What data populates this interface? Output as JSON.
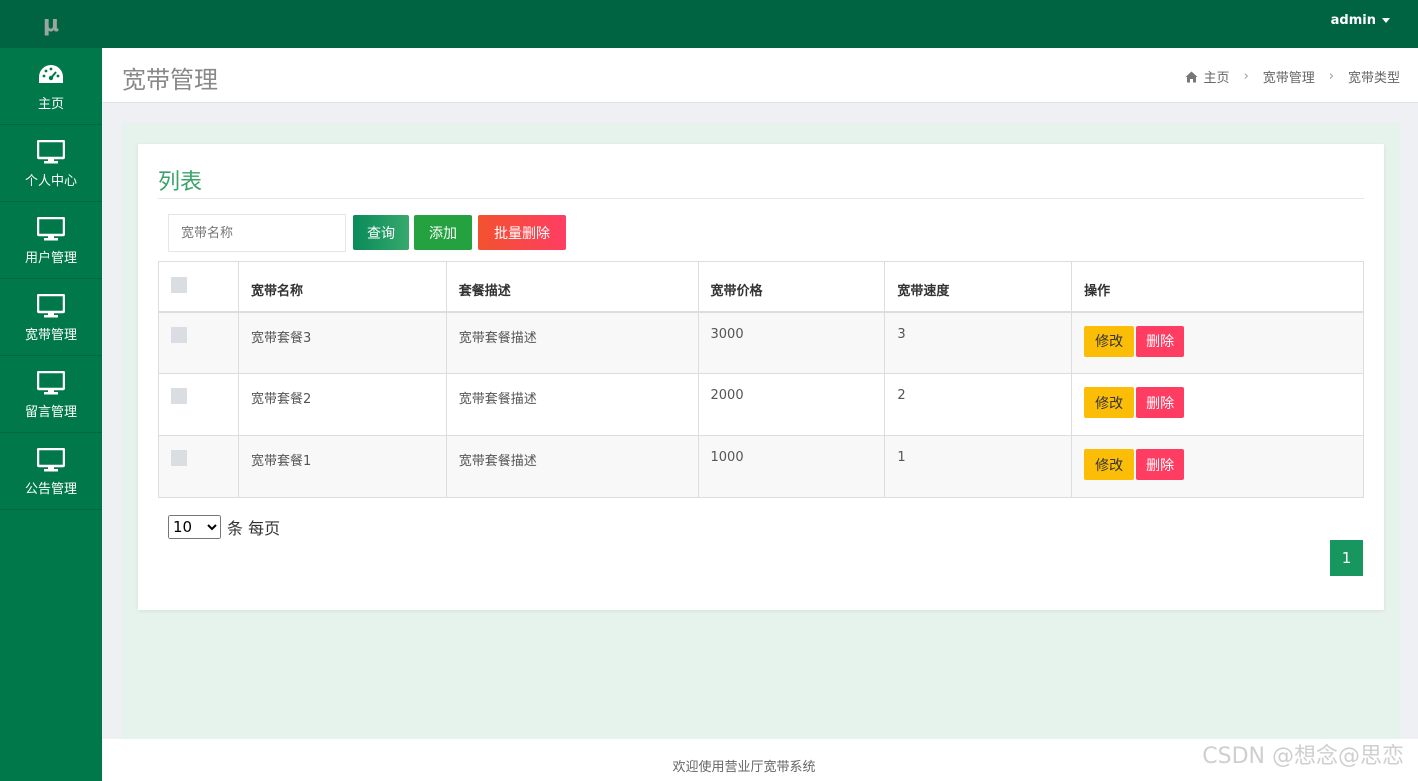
{
  "app": {
    "logo": "μ"
  },
  "sidebar": {
    "items": [
      {
        "label": "主页",
        "icon": "dashboard-icon"
      },
      {
        "label": "个人中心",
        "icon": "monitor-icon"
      },
      {
        "label": "用户管理",
        "icon": "monitor-icon"
      },
      {
        "label": "宽带管理",
        "icon": "monitor-icon"
      },
      {
        "label": "留言管理",
        "icon": "monitor-icon"
      },
      {
        "label": "公告管理",
        "icon": "monitor-icon"
      }
    ]
  },
  "topbar": {
    "user": "admin"
  },
  "header": {
    "title": "宽带管理",
    "breadcrumb": [
      "主页",
      "宽带管理",
      "宽带类型"
    ]
  },
  "card": {
    "title": "列表",
    "search_placeholder": "宽带名称",
    "query_label": "查询",
    "add_label": "添加",
    "batch_delete_label": "批量删除"
  },
  "table": {
    "columns": [
      "宽带名称",
      "套餐描述",
      "宽带价格",
      "宽带速度",
      "操作"
    ],
    "rows": [
      {
        "name": "宽带套餐3",
        "desc": "宽带套餐描述",
        "price": "3000",
        "speed": "3"
      },
      {
        "name": "宽带套餐2",
        "desc": "宽带套餐描述",
        "price": "2000",
        "speed": "2"
      },
      {
        "name": "宽带套餐1",
        "desc": "宽带套餐描述",
        "price": "1000",
        "speed": "1"
      }
    ],
    "edit_label": "修改",
    "delete_label": "删除"
  },
  "pagination": {
    "page_size": "10",
    "page_size_suffix": "条 每页",
    "current_page": "1"
  },
  "footer": {
    "text": "欢迎使用营业厅宽带系统"
  },
  "watermark": "CSDN @想念@思恋",
  "colors": {
    "sidebar": "#00784a",
    "topbar": "#006341",
    "accent": "#3aa36b",
    "edit": "#fcbd06",
    "delete": "#ff3d62"
  }
}
